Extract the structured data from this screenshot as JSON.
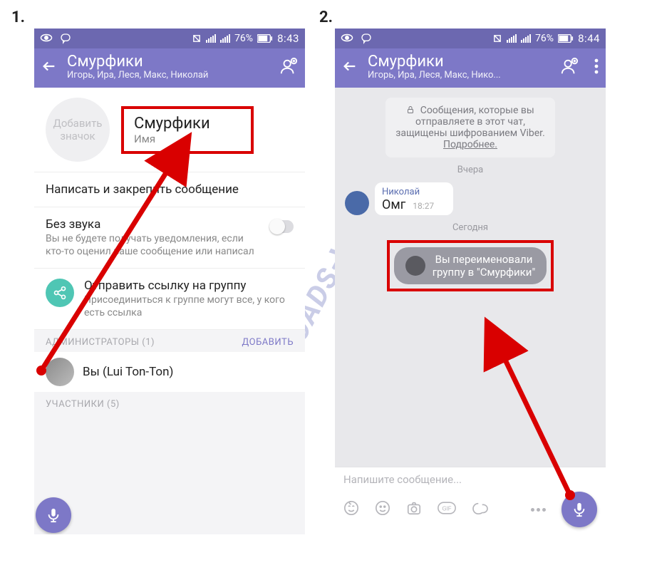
{
  "labels": {
    "panel1": "1.",
    "panel2": "2."
  },
  "watermark": "DOWNLOADS-VIBER.CO",
  "status1": {
    "battery_pct": "76%",
    "time": "8:43"
  },
  "status2": {
    "battery_pct": "76%",
    "time": "8:44"
  },
  "header1": {
    "title": "Смурфики",
    "subtitle": "Игорь, Ира, Леся, Макс, Николай"
  },
  "header2": {
    "title": "Смурфики",
    "subtitle": "Игорь, Ира, Леся, Макс, Нико..."
  },
  "settings": {
    "avatar_label_l1": "Добавить",
    "avatar_label_l2": "значок",
    "group_name": "Смурфики",
    "group_name_sub": "Имя",
    "pin_text": "Написать и закрепить сообщение",
    "mute_title": "Без звука",
    "mute_desc": "Вы не будете получать уведомления, если кто-то оценил ваше сообщение или написал",
    "share_title": "Отправить ссылку на группу",
    "share_desc": "Присоединиться к группе могут все, у кого есть ссылка",
    "admins_header": "АДМИНИСТРАТОРЫ (1)",
    "add_link": "ДОБАВИТЬ",
    "admin_name": "Вы (Lui Ton-Ton)",
    "members_header": "УЧАСТНИКИ (5)"
  },
  "chat": {
    "encryption_l1": "Сообщения, которые вы",
    "encryption_l2": "отправляете в этот чат,",
    "encryption_l3": "защищены шифрованием Viber.",
    "encryption_link": "Подробнее.",
    "day_yesterday": "Вчера",
    "day_today": "Сегодня",
    "msg_sender": "Николай",
    "msg_text": "Омг",
    "msg_time": "18:27",
    "sys_msg_l1": "Вы переименовали",
    "sys_msg_l2": "группу в \"Смурфики\"",
    "input_placeholder": "Напишите сообщение..."
  }
}
